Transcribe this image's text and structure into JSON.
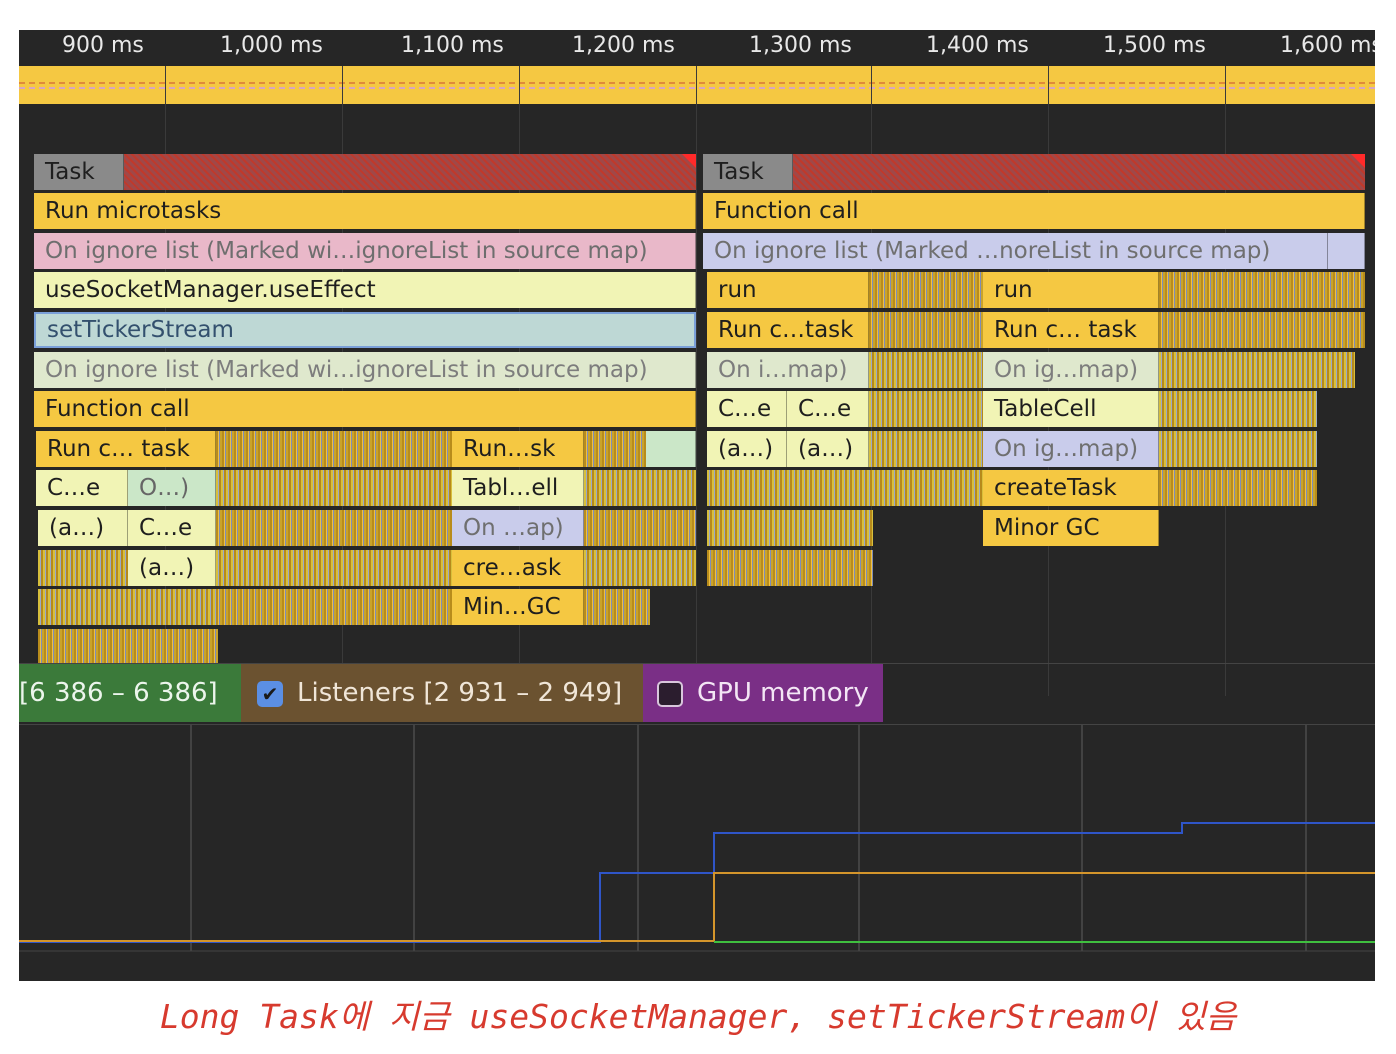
{
  "ruler": {
    "ticks": [
      "900 ms",
      "1,000 ms",
      "1,100 ms",
      "1,200 ms",
      "1,300 ms",
      "1,400 ms",
      "1,500 ms",
      "1,600 ms"
    ]
  },
  "flame_left": {
    "task": "Task",
    "run_microtasks": "Run microtasks",
    "ignore1": "On ignore list (Marked wi…ignoreList in source map)",
    "use_effect": "useSocketManager.useEffect",
    "set_ticker": "setTickerStream",
    "ignore2": "On ignore list (Marked wi…ignoreList in source map)",
    "function_call": "Function call",
    "run_task": "Run c… task",
    "run_sk": "Run…sk",
    "ce1": "C…e",
    "o": "O…)",
    "tablell": "Tabl…ell",
    "a1": "(a…)",
    "ce2": "C…e",
    "on_ap": "On …ap)",
    "a2": "(a…)",
    "cre_ask": "cre…ask",
    "min_gc": "Min…GC"
  },
  "flame_right": {
    "task": "Task",
    "function_call": "Function call",
    "ignore1": "On ignore list (Marked …noreList in source map)",
    "run_a": "run",
    "run_b": "run",
    "run_task_a": "Run c…task",
    "run_task_b": "Run c… task",
    "on_map_a": "On i…map)",
    "on_map_b": "On ig…map)",
    "ce_a": "C…e",
    "ce_b": "C…e",
    "table_cell": "TableCell",
    "a_a": "(a…)",
    "a_b": "(a…)",
    "on_map_c": "On ig…map)",
    "create_task": "createTask",
    "minor_gc": "Minor GC"
  },
  "legend": {
    "nodes": "[6 386 – 6 386]",
    "listeners": "Listeners [2 931 – 2 949]",
    "listeners_checked": true,
    "gpu": "GPU memory",
    "gpu_checked": false
  },
  "colors": {
    "panel": "#262626",
    "task_yellow": "#f5c842",
    "nodes_green": "#3b7a3a",
    "listeners_brown": "#6b5230",
    "gpu_purple": "#7a2f86",
    "line_blue": "#2f55c8",
    "line_orange": "#d4952b",
    "line_green": "#3fbf3f",
    "caption_red": "#d73a2e"
  },
  "caption": "Long Task에 지금 useSocketManager, setTickerStream이 있음"
}
